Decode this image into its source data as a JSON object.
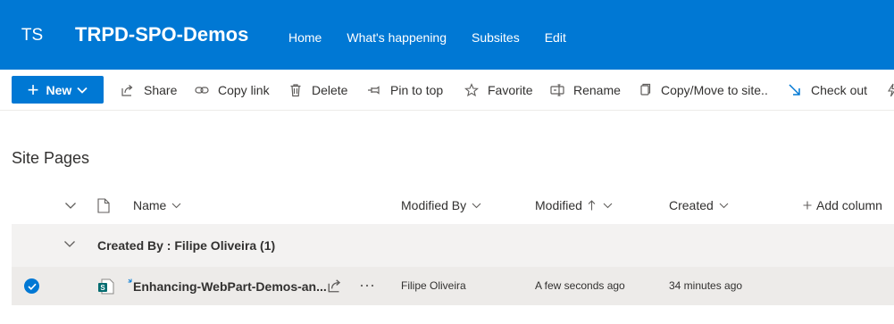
{
  "header": {
    "site_logo": "TS",
    "site_title": "TRPD-SPO-Demos",
    "nav": [
      "Home",
      "What's happening",
      "Subsites",
      "Edit"
    ],
    "color": "#0078d4"
  },
  "command_bar": {
    "new_label": "New",
    "commands": [
      {
        "label": "Share",
        "icon": "share-icon"
      },
      {
        "label": "Copy link",
        "icon": "link-icon"
      },
      {
        "label": "Delete",
        "icon": "trash-icon"
      },
      {
        "label": "Pin to top",
        "icon": "pin-icon"
      },
      {
        "label": "Favorite",
        "icon": "star-icon"
      },
      {
        "label": "Rename",
        "icon": "rename-icon"
      },
      {
        "label": "Copy/Move to site..",
        "icon": "copy-icon"
      },
      {
        "label": "Check out",
        "icon": "check-out-icon"
      }
    ]
  },
  "list": {
    "title": "Site Pages",
    "columns": {
      "name": "Name",
      "modified_by": "Modified By",
      "modified": "Modified",
      "created": "Created",
      "add_column": "Add column"
    },
    "group": {
      "label": "Created By : Filipe Oliveira (1)"
    },
    "rows": [
      {
        "name": "Enhancing-WebPart-Demos-an...",
        "modified_by": "Filipe Oliveira",
        "modified": "A few seconds ago",
        "created": "34 minutes ago",
        "selected": true
      }
    ]
  }
}
